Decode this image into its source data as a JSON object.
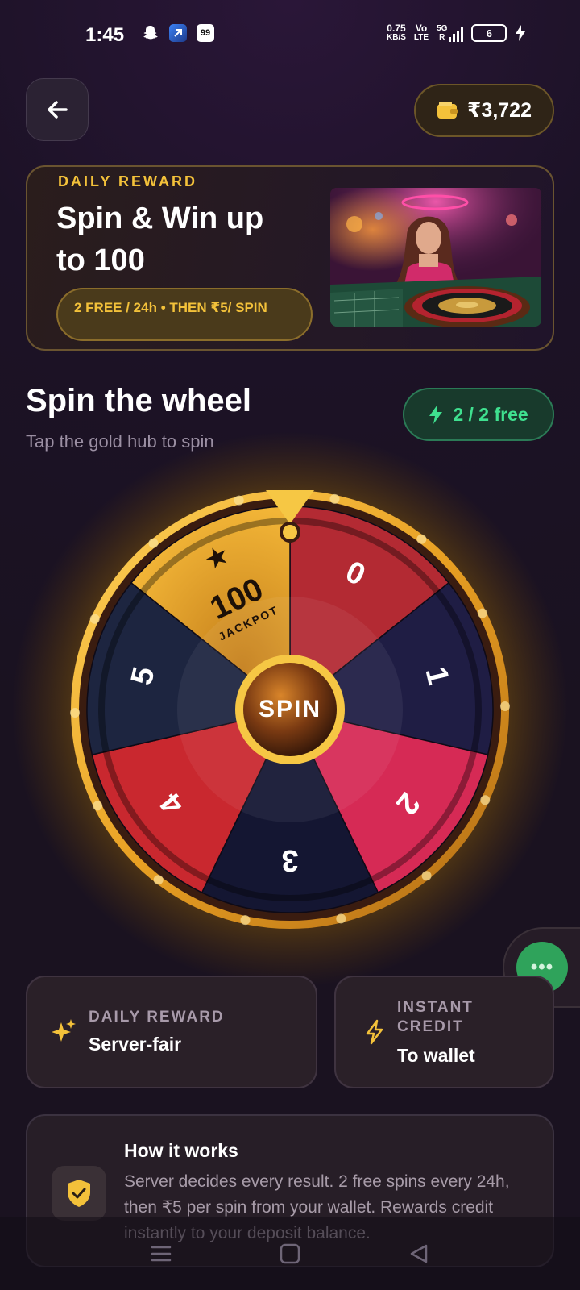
{
  "status_bar": {
    "time": "1:45",
    "net_speed_value": "0.75",
    "net_speed_unit": "KB/S",
    "volte_top": "Vo",
    "volte_bottom": "LTE",
    "network": "5G",
    "roaming": "R",
    "battery": "6",
    "notif_badge": "99"
  },
  "header": {
    "wallet_amount": "₹3,722"
  },
  "promo": {
    "eyebrow": "DAILY REWARD",
    "title": "Spin & Win up to 100",
    "pill": "2 FREE / 24h • THEN ₹5/ SPIN"
  },
  "wheel_section": {
    "title": "Spin the wheel",
    "subtitle": "Tap the gold hub to spin",
    "free_chip": "2 / 2 free",
    "spin_label": "SPIN",
    "segments": [
      {
        "label": "0",
        "color": "#b32a33"
      },
      {
        "label": "1",
        "color": "#1f1d44"
      },
      {
        "label": "2",
        "color": "#d62a55"
      },
      {
        "label": "3",
        "color": "#141632"
      },
      {
        "label": "4",
        "color": "#c9282f"
      },
      {
        "label": "5",
        "color": "#1d2540"
      },
      {
        "label": "100",
        "sub_label": "JACKPOT",
        "color": "#e2a424"
      }
    ]
  },
  "features": [
    {
      "eyebrow": "DAILY REWARD",
      "value": "Server-fair",
      "icon": "sparkles-icon"
    },
    {
      "eyebrow": "INSTANT CREDIT",
      "eyebrow_line1": "INSTANT",
      "eyebrow_line2": "CREDIT",
      "value": "To wallet",
      "icon": "lightning-icon"
    }
  ],
  "how_it_works": {
    "title": "How it works",
    "body": "Server decides every result. 2 free spins every 24h, then ₹5 per spin from your wallet. Rewards credit instantly to your deposit balance."
  },
  "floating": {
    "label": "•••"
  },
  "colors": {
    "gold": "#f3c13a",
    "green": "#3fe08f",
    "background": "#1c1226"
  }
}
